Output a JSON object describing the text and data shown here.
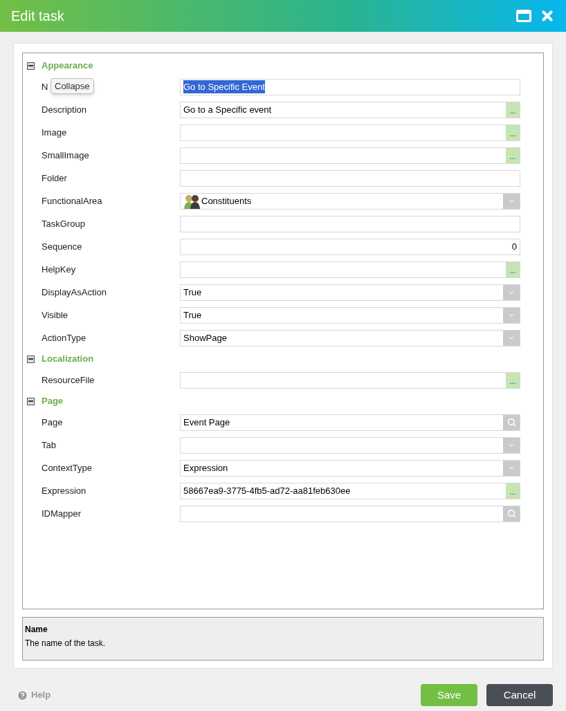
{
  "window": {
    "title": "Edit task"
  },
  "tooltip": "Collapse",
  "groups": [
    {
      "title": "Appearance",
      "expanded": true,
      "properties": [
        {
          "label": "N",
          "kind": "text",
          "value": "Go to Specific Event",
          "highlighted": true
        },
        {
          "label": "Description",
          "kind": "browse",
          "value": "Go to a Specific event",
          "button": "..."
        },
        {
          "label": "Image",
          "kind": "browse",
          "button": "..."
        },
        {
          "label": "SmallImage",
          "kind": "browse",
          "button": "..."
        },
        {
          "label": "Folder",
          "kind": "text"
        },
        {
          "label": "FunctionalArea",
          "kind": "icon_select",
          "value": "Constituents"
        },
        {
          "label": "TaskGroup",
          "kind": "text"
        },
        {
          "label": "Sequence",
          "kind": "number",
          "value": "0"
        },
        {
          "label": "HelpKey",
          "kind": "browse",
          "button": "..."
        },
        {
          "label": "DisplayAsAction",
          "kind": "select",
          "value": "True"
        },
        {
          "label": "Visible",
          "kind": "select",
          "value": "True"
        },
        {
          "label": "ActionType",
          "kind": "select",
          "value": "ShowPage"
        }
      ]
    },
    {
      "title": "Localization",
      "expanded": true,
      "properties": [
        {
          "label": "ResourceFile",
          "kind": "browse",
          "button": "..."
        }
      ]
    },
    {
      "title": "Page",
      "expanded": true,
      "properties": [
        {
          "label": "Page",
          "kind": "search",
          "value": "Event Page"
        },
        {
          "label": "Tab",
          "kind": "select"
        },
        {
          "label": "ContextType",
          "kind": "select",
          "value": "Expression"
        },
        {
          "label": "Expression",
          "kind": "browse",
          "value": "58667ea9-3775-4fb5-ad72-aa81feb630ee",
          "button": "..."
        },
        {
          "label": "IDMapper",
          "kind": "search"
        }
      ]
    }
  ],
  "description": {
    "title": "Name",
    "text": "The name of the task."
  },
  "footer": {
    "help": "Help",
    "buttons": [
      {
        "label": "Save",
        "kind": "primary"
      },
      {
        "label": "Cancel",
        "kind": "secondary"
      }
    ]
  }
}
